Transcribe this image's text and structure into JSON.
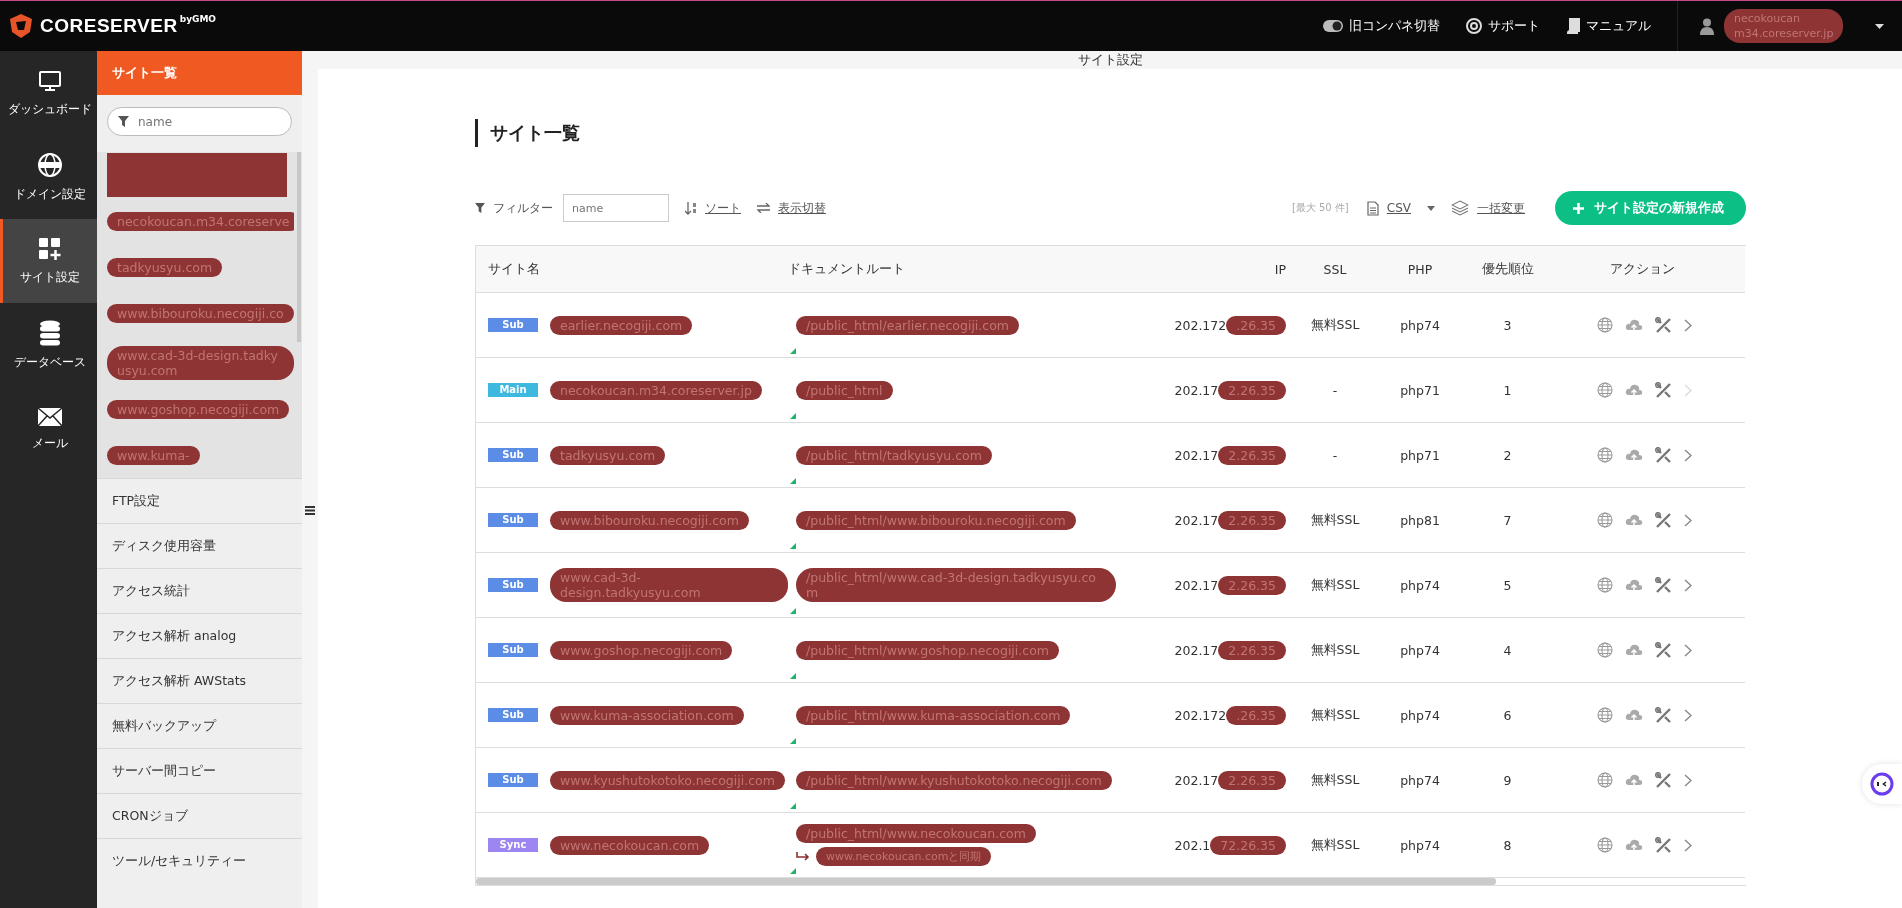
{
  "header": {
    "logo": "CORESERVER",
    "logo_sub": "byGMO",
    "links": [
      {
        "kind": "toggle",
        "label": "旧コンパネ切替"
      },
      {
        "kind": "support",
        "label": "サポート"
      },
      {
        "kind": "manual",
        "label": "マニュアル"
      }
    ],
    "account": {
      "lines": [
        "necokoucan",
        "m34.coreserver.jp"
      ],
      "redacted": true
    }
  },
  "rail": [
    {
      "kind": "monitor",
      "label": "ダッシュボード",
      "selected": false
    },
    {
      "kind": "www",
      "label": "ドメイン設定",
      "selected": false
    },
    {
      "kind": "grid",
      "label": "サイト設定",
      "selected": true
    },
    {
      "kind": "database",
      "label": "データベース",
      "selected": false
    },
    {
      "kind": "mail",
      "label": "メール",
      "selected": false
    }
  ],
  "subnav": {
    "title": "サイト一覧",
    "search": {
      "placeholder": "name"
    },
    "sites": [
      {
        "redacted": true
      },
      {
        "label": "necokoucan.m34.coreserve",
        "redacted": true
      },
      {
        "label": "tadkyusyu.com",
        "redacted": true
      },
      {
        "label": "www.bibouroku.necogiji.co",
        "redacted": true
      },
      {
        "label": "www.cad-3d-design.tadkyusyu.com",
        "redacted": true
      },
      {
        "label": "www.goshop.necogiji.com",
        "redacted": true
      },
      {
        "label": "www.kuma-",
        "redacted": true
      }
    ],
    "menu": [
      "FTP設定",
      "ディスク使用容量",
      "アクセス統計",
      "アクセス解析 analog",
      "アクセス解析 AWStats",
      "無料バックアップ",
      "サーバー間コピー",
      "CRONジョブ",
      "ツール/セキュリティー"
    ]
  },
  "breadcrumb": "サイト設定",
  "page_title": "サイト一覧",
  "toolbar": {
    "filter_label": "フィルター",
    "filter": {
      "placeholder": "name"
    },
    "sort": "ソート",
    "view_toggle": "表示切替",
    "limit": "[最大 50 件]",
    "csv": "CSV",
    "bulk": "一括変更",
    "create": "サイト設定の新規作成"
  },
  "table": {
    "columns": [
      "サイト名",
      "ドキュメントルート",
      "IP",
      "SSL",
      "PHP",
      "優先順位",
      "アクション"
    ],
    "rows": [
      {
        "type": "Sub",
        "name": "earlier.necogiji.com",
        "docroot": "/public_html/earlier.necogiji.com",
        "ip": "202.172",
        "ip_hidden": ".26.35",
        "ssl": "無料SSL",
        "php": "php74",
        "priority": "3",
        "redacted": true,
        "next_disabled": false
      },
      {
        "type": "Main",
        "name": "necokoucan.m34.coreserver.jp",
        "docroot": "/public_html",
        "ip": "202.17",
        "ip_hidden": "2.26.35",
        "ssl": "-",
        "php": "php71",
        "priority": "1",
        "redacted": true,
        "next_disabled": true
      },
      {
        "type": "Sub",
        "name": "tadkyusyu.com",
        "docroot": "/public_html/tadkyusyu.com",
        "ip": "202.17",
        "ip_hidden": "2.26.35",
        "ssl": "-",
        "php": "php71",
        "priority": "2",
        "redacted": true,
        "next_disabled": false
      },
      {
        "type": "Sub",
        "name": "www.bibouroku.necogiji.com",
        "docroot": "/public_html/www.bibouroku.necogiji.com",
        "ip": "202.17",
        "ip_hidden": "2.26.35",
        "ssl": "無料SSL",
        "php": "php81",
        "priority": "7",
        "redacted": true,
        "next_disabled": false
      },
      {
        "type": "Sub",
        "name": "www.cad-3d-design.tadkyusyu.com",
        "docroot": "/public_html/www.cad-3d-design.tadkyusyu.com",
        "ip": "202.17",
        "ip_hidden": "2.26.35",
        "ssl": "無料SSL",
        "php": "php74",
        "priority": "5",
        "redacted": true,
        "next_disabled": false
      },
      {
        "type": "Sub",
        "name": "www.goshop.necogiji.com",
        "docroot": "/public_html/www.goshop.necogiji.com",
        "ip": "202.17",
        "ip_hidden": "2.26.35",
        "ssl": "無料SSL",
        "php": "php74",
        "priority": "4",
        "redacted": true,
        "next_disabled": false
      },
      {
        "type": "Sub",
        "name": "www.kuma-association.com",
        "docroot": "/public_html/www.kuma-association.com",
        "ip": "202.172",
        "ip_hidden": ".26.35",
        "ssl": "無料SSL",
        "php": "php74",
        "priority": "6",
        "redacted": true,
        "next_disabled": false
      },
      {
        "type": "Sub",
        "name": "www.kyushutokotoko.necogiji.com",
        "docroot": "/public_html/www.kyushutokotoko.necogiji.com",
        "ip": "202.17",
        "ip_hidden": "2.26.35",
        "ssl": "無料SSL",
        "php": "php74",
        "priority": "9",
        "redacted": true,
        "next_disabled": false
      },
      {
        "type": "Sync",
        "name": "www.necokoucan.com",
        "docroot": "/public_html/www.necokoucan.com",
        "sync_note": "www.necokoucan.comと同期",
        "ip": "202.1",
        "ip_hidden": "72.26.35",
        "ssl": "無料SSL",
        "php": "php74",
        "priority": "8",
        "redacted": true,
        "next_disabled": false
      }
    ]
  }
}
